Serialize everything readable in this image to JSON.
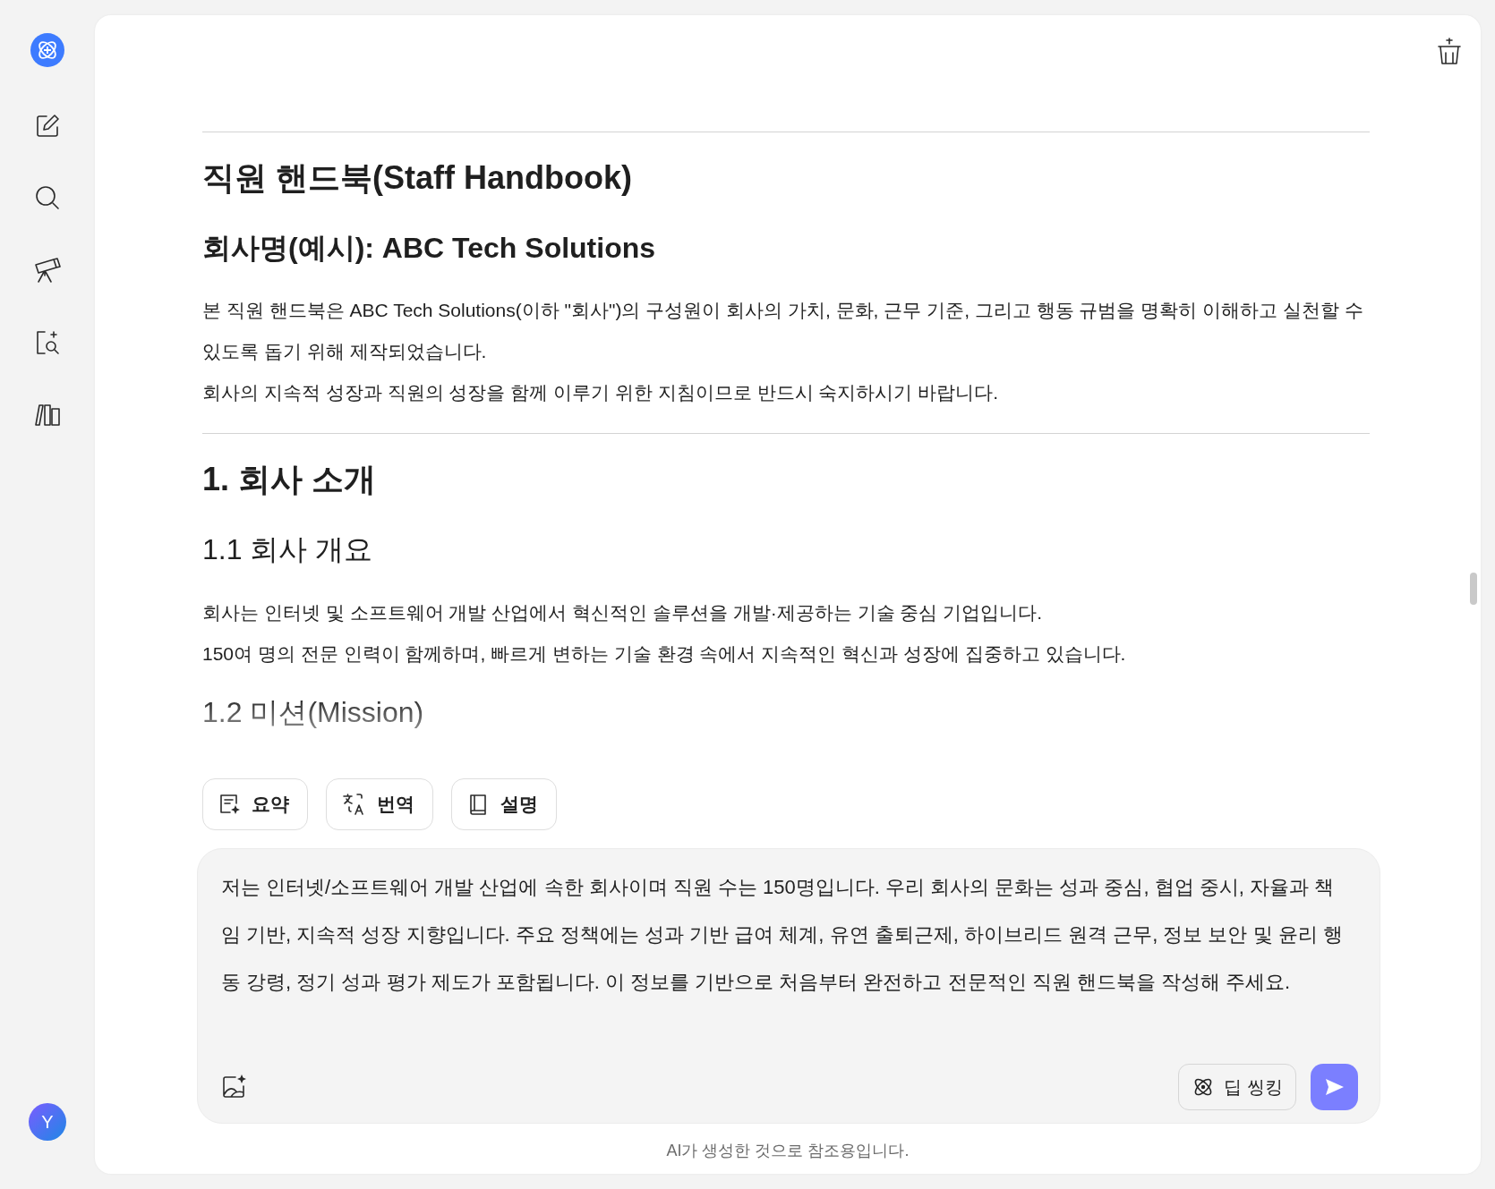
{
  "sidebar": {
    "avatar": "Y"
  },
  "document": {
    "blocks": [
      {
        "kind": "rule"
      },
      {
        "kind": "h1",
        "text": "직원 핸드북(Staff Handbook)"
      },
      {
        "kind": "h2",
        "text": "회사명(예시): ABC Tech Solutions"
      },
      {
        "kind": "p",
        "text": "본 직원 핸드북은 ABC Tech Solutions(이하 \"회사\")의 구성원이 회사의 가치, 문화, 근무 기준, 그리고 행동 규범을 명확히 이해하고 실천할 수 있도록 돕기 위해 제작되었습니다."
      },
      {
        "kind": "p",
        "text": "회사의 지속적 성장과 직원의 성장을 함께 이루기 위한 지침이므로 반드시 숙지하시기 바랍니다."
      },
      {
        "kind": "rule"
      },
      {
        "kind": "h1",
        "text": "1. 회사 소개"
      },
      {
        "kind": "h3",
        "text": "1.1 회사 개요"
      },
      {
        "kind": "p",
        "text": "회사는 인터넷 및 소프트웨어 개발 산업에서 혁신적인 솔루션을 개발·제공하는 기술 중심 기업입니다."
      },
      {
        "kind": "p",
        "text": "150여 명의 전문 인력이 함께하며, 빠르게 변하는 기술 환경 속에서 지속적인 혁신과 성장에 집중하고 있습니다."
      },
      {
        "kind": "h3",
        "text": "1.2 미션(Mission)"
      }
    ]
  },
  "actions": [
    {
      "kind": "summary",
      "label": "요약"
    },
    {
      "kind": "translate",
      "label": "번역"
    },
    {
      "kind": "explain",
      "label": "설명"
    }
  ],
  "prompt": {
    "value": "저는 인터넷/소프트웨어 개발 산업에 속한 회사이며 직원 수는 150명입니다. 우리 회사의 문화는 성과 중심, 협업 중시, 자율과 책임 기반, 지속적 성장 지향입니다. 주요 정책에는 성과 기반 급여 체계, 유연 출퇴근제, 하이브리드 원격 근무, 정보 보안 및 윤리 행동 강령, 정기 성과 평가 제도가 포함됩니다. 이 정보를 기반으로 처음부터 완전하고 전문적인 직원 핸드북을 작성해 주세요.",
    "deep_think": {
      "label": "딥 씽킹",
      "on": false
    }
  },
  "footer_note": "AI가 생성한 것으로 참조용입니다."
}
